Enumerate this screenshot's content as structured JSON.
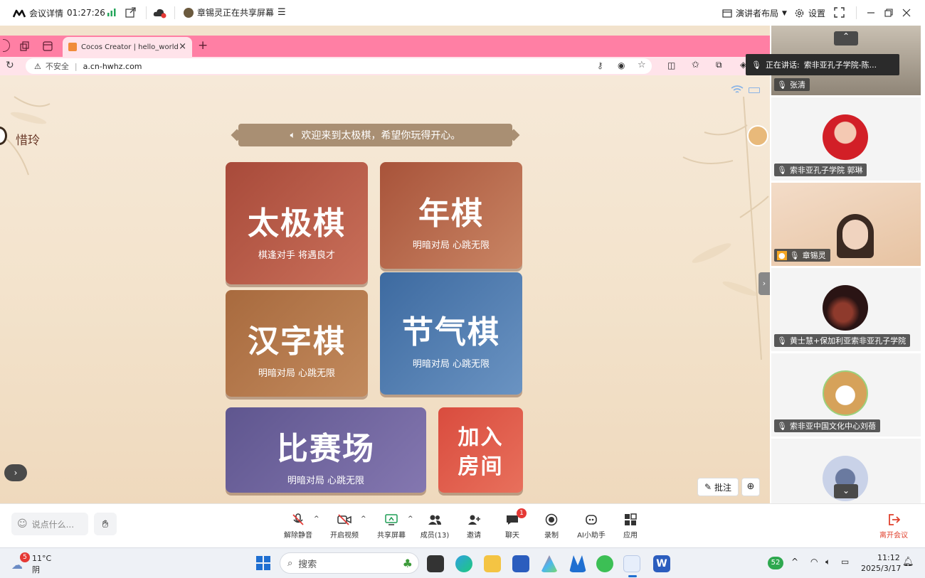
{
  "topbar": {
    "meeting_details": "会议详情",
    "timer": "01:27:26",
    "sharing_status": "章锡灵正在共享屏幕",
    "layout_label": "演讲者布局",
    "settings_label": "设置"
  },
  "browser": {
    "tab_title": "Cocos Creator | hello_world",
    "security": "不安全",
    "url": "a.cn-hwhz.com"
  },
  "game": {
    "player_name": "惜玲",
    "welcome": "欢迎来到太极棋，希望你玩得开心。",
    "tiles": [
      {
        "title": "太极棋",
        "subtitle": "棋逢对手 将遇良才"
      },
      {
        "title": "年棋",
        "subtitle": "明暗对局 心跳无限"
      },
      {
        "title": "汉字棋",
        "subtitle": "明暗对局 心跳无限"
      },
      {
        "title": "节气棋",
        "subtitle": "明暗对局 心跳无限"
      },
      {
        "title": "比赛场",
        "subtitle": "明暗对局 心跳无限"
      },
      {
        "title_line1": "加入",
        "title_line2": "房间"
      }
    ],
    "annotate_label": "批注"
  },
  "sidebar": {
    "speaking_prefix": "正在讲话:",
    "speaking_name": "索非亚孔子学院-陈...",
    "participants": [
      {
        "name": "张清"
      },
      {
        "name": "索非亚孔子学院  郭琳"
      },
      {
        "name": "章锡灵"
      },
      {
        "name": "黄士慧+保加利亚索非亚孔子学院"
      },
      {
        "name": "索非亚中国文化中心刘蓓"
      }
    ]
  },
  "toolbar": {
    "chat_placeholder": "说点什么...",
    "buttons": {
      "unmute": "解除静音",
      "video": "开启视频",
      "share": "共享屏幕",
      "members": "成员(13)",
      "invite": "邀请",
      "chat": "聊天",
      "record": "录制",
      "ai": "AI小助手",
      "apps": "应用",
      "leave": "离开会议"
    },
    "chat_badge": "1"
  },
  "taskbar": {
    "weather_badge": "5",
    "temperature": "11°C",
    "weather": "阴",
    "search_placeholder": "搜索",
    "tray_badge": "52",
    "time": "11:12",
    "date": "2025/3/17"
  },
  "colors": {
    "tile_taiji": "#b8553f",
    "tile_year": "#b8674b",
    "tile_hanzi": "#b27449",
    "tile_jieqi": "#4d7aae",
    "tile_arena": "#6f64a0",
    "tile_join": "#e2584a",
    "tabstrip": "#ff7fa4",
    "leave": "#e0412d"
  }
}
